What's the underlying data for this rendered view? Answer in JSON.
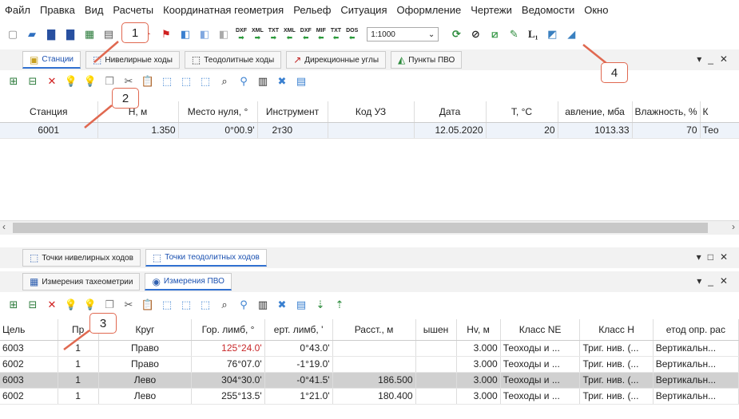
{
  "menu": [
    "Файл",
    "Правка",
    "Вид",
    "Расчеты",
    "Координатная геометрия",
    "Рельеф",
    "Ситуация",
    "Оформление",
    "Чертежи",
    "Ведомости",
    "Окно"
  ],
  "toolbar": {
    "scale": "1:1000",
    "dxf": "DXF",
    "xml": "XML",
    "txt": "TXT",
    "mif": "MIF",
    "dos": "DOS"
  },
  "tabs_top": [
    {
      "label": "Станции",
      "active": true
    },
    {
      "label": "Нивелирные ходы"
    },
    {
      "label": "Теодолитные ходы"
    },
    {
      "label": "Дирекционные углы"
    },
    {
      "label": "Пункты ПВО"
    }
  ],
  "stations_table": {
    "columns": [
      "Станция",
      "Н, м",
      "Место нуля, °",
      "Инструмент",
      "Код УЗ",
      "Дата",
      "T, °C",
      "авление, мба",
      "Влажность, %",
      "К"
    ],
    "rows": [
      [
        "6001",
        "1.350",
        "0°00.9'",
        "2т30",
        "",
        "12.05.2020",
        "20",
        "1013.33",
        "70",
        "Тео"
      ]
    ]
  },
  "tabs_mid": [
    {
      "label": "Точки нивелирных ходов"
    },
    {
      "label": "Точки теодолитных ходов",
      "active": true
    }
  ],
  "tabs_low": [
    {
      "label": "Измерения тахеометрии"
    },
    {
      "label": "Измерения ПВО",
      "active": true
    }
  ],
  "measure_table": {
    "columns": [
      "Цель",
      "Пр",
      "Круг",
      "Гор. лимб, °",
      "ерт. лимб, '",
      "Расст., м",
      "ышен",
      "Hv, м",
      "Класс NE",
      "Класс H",
      "етод опр. рас"
    ],
    "rows": [
      [
        "6003",
        "1",
        "Право",
        "125°24.0'",
        "0°43.0'",
        "",
        "",
        "3.000",
        "Теоходы и ...",
        "Триг. нив. (...",
        "Вертикальн..."
      ],
      [
        "6002",
        "1",
        "Право",
        "76°07.0'",
        "-1°19.0'",
        "",
        "",
        "3.000",
        "Теоходы и ...",
        "Триг. нив. (...",
        "Вертикальн..."
      ],
      [
        "6003",
        "1",
        "Лево",
        "304°30.0'",
        "-0°41.5'",
        "186.500",
        "",
        "3.000",
        "Теоходы и ...",
        "Триг. нив. (...",
        "Вертикальн..."
      ],
      [
        "6002",
        "1",
        "Лево",
        "255°13.5'",
        "1°21.0'",
        "180.400",
        "",
        "3.000",
        "Теоходы и ...",
        "Триг. нив. (...",
        "Вертикальн..."
      ]
    ]
  },
  "callouts": [
    "1",
    "2",
    "3",
    "4"
  ],
  "colors": {
    "callout_border": "#e06850",
    "red_value": "#c8282a",
    "active_tab": "#1a50b0"
  }
}
